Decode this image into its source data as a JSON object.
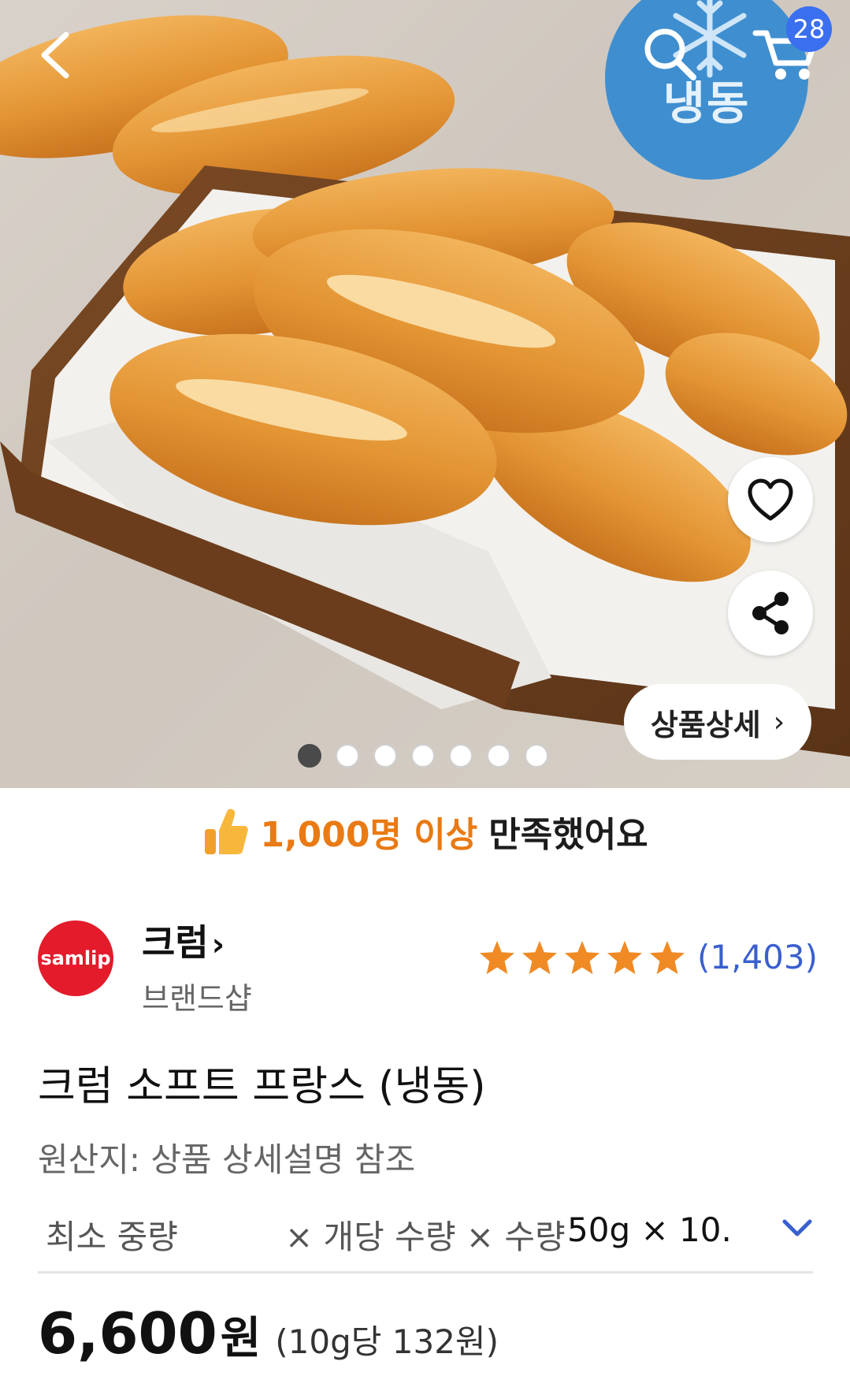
{
  "header": {
    "freeze_badge": "냉동",
    "cart_count": "28",
    "icons": [
      "back-icon",
      "search-icon",
      "cart-icon",
      "snowflake-icon"
    ]
  },
  "gallery": {
    "dots_total": 7,
    "active_index": 0,
    "detail_button": "상품상세",
    "detail_chevron": "›"
  },
  "satisfaction": {
    "highlight": "1,000명 이상",
    "rest": "만족했어요"
  },
  "brand": {
    "logo_text": "samlip",
    "name": "크럼",
    "name_arrow": "›",
    "subtitle": "브랜드샵",
    "rating_stars": 5,
    "review_count": "(1,403)"
  },
  "product": {
    "title": "크럼 소프트 프랑스 (냉동)",
    "origin": "원산지: 상품 상세설명 참조",
    "spec_label_1": "최소 중량",
    "spec_label_2": "× 개당 수량 × 수량",
    "spec_value": "50g × 10...",
    "price": "6,600",
    "price_unit": "원",
    "unit_price": "(10g당 132원)"
  },
  "colors": {
    "accent_orange": "#e97a14",
    "review_blue": "#3a5fcf",
    "cart_badge": "#3a6ff0",
    "freeze_blue": "#3f8fd0",
    "brand_red": "#e31b2a"
  }
}
